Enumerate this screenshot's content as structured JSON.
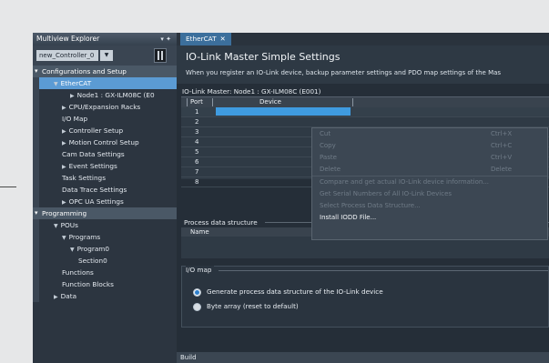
{
  "explorer": {
    "title": "Multiview Explorer",
    "pin": "▾ ✦",
    "controller_select": "new_Controller_0",
    "controller_dropdown": "▼",
    "tree": [
      {
        "label": "Configurations and Setup",
        "kind": "section",
        "indent": 0
      },
      {
        "label": "EtherCAT",
        "kind": "selected",
        "indent": 1,
        "twisty": "▼"
      },
      {
        "label": "Node1 : GX-ILM08C (E0",
        "kind": "item",
        "indent": 3,
        "twisty": "▶"
      },
      {
        "label": "CPU/Expansion Racks",
        "kind": "item",
        "indent": 2,
        "twisty": "▶"
      },
      {
        "label": "I/O Map",
        "kind": "item",
        "indent": 2,
        "twisty": ""
      },
      {
        "label": "Controller Setup",
        "kind": "item",
        "indent": 2,
        "twisty": "▶"
      },
      {
        "label": "Motion Control Setup",
        "kind": "item",
        "indent": 2,
        "twisty": "▶"
      },
      {
        "label": "Cam Data Settings",
        "kind": "item",
        "indent": 2,
        "twisty": ""
      },
      {
        "label": "Event Settings",
        "kind": "item",
        "indent": 2,
        "twisty": "▶"
      },
      {
        "label": "Task Settings",
        "kind": "item",
        "indent": 2,
        "twisty": ""
      },
      {
        "label": "Data Trace Settings",
        "kind": "item",
        "indent": 2,
        "twisty": ""
      },
      {
        "label": "OPC UA Settings",
        "kind": "item",
        "indent": 2,
        "twisty": "▶"
      },
      {
        "label": "Programming",
        "kind": "section",
        "indent": 0
      },
      {
        "label": "POUs",
        "kind": "item",
        "indent": 1,
        "twisty": "▼"
      },
      {
        "label": "Programs",
        "kind": "item",
        "indent": 2,
        "twisty": "▼"
      },
      {
        "label": "Program0",
        "kind": "item",
        "indent": 3,
        "twisty": "▼"
      },
      {
        "label": "Section0",
        "kind": "item",
        "indent": 4,
        "twisty": ""
      },
      {
        "label": "Functions",
        "kind": "item",
        "indent": 2,
        "twisty": ""
      },
      {
        "label": "Function Blocks",
        "kind": "item",
        "indent": 2,
        "twisty": ""
      },
      {
        "label": "Data",
        "kind": "item",
        "indent": 1,
        "twisty": "▶"
      }
    ]
  },
  "editor": {
    "tab_label": "EtherCAT",
    "tab_close": "✕",
    "title": "IO-Link Master Simple Settings",
    "description": "When you register an IO-Link device, backup parameter settings and PDO map settings of the Mas",
    "master_label": "IO-Link Master:  Node1 : GX-ILM08C (E001)",
    "port_header": "Port",
    "device_header": "Device",
    "ports": [
      "1",
      "2",
      "3",
      "4",
      "5",
      "6",
      "7",
      "8"
    ]
  },
  "process_data": {
    "title": "Process data structure",
    "name_header": "Name"
  },
  "io_map": {
    "title": "I/O map",
    "options": [
      {
        "label": "Generate process data structure of the IO-Link device",
        "selected": true
      },
      {
        "label": "Byte array (reset to default)",
        "selected": false
      }
    ]
  },
  "context_menu": [
    {
      "label": "Cut",
      "shortcut": "Ctrl+X",
      "enabled": false
    },
    {
      "label": "Copy",
      "shortcut": "Ctrl+C",
      "enabled": false
    },
    {
      "label": "Paste",
      "shortcut": "Ctrl+V",
      "enabled": false
    },
    {
      "label": "Delete",
      "shortcut": "Delete",
      "enabled": false
    },
    {
      "label": "Compare and get actual IO-Link device information...",
      "shortcut": "",
      "enabled": false
    },
    {
      "label": "Get Serial Numbers of All IO-Link Devices",
      "shortcut": "",
      "enabled": false
    },
    {
      "label": "Select Process Data Structure...",
      "shortcut": "",
      "enabled": false
    },
    {
      "label": "Install IODD File...",
      "shortcut": "",
      "enabled": true
    }
  ],
  "status_bar": {
    "label": "Build"
  },
  "colors": {
    "selection": "#5b9bd4",
    "accent": "#3f9be0",
    "background": "#1f2730"
  }
}
